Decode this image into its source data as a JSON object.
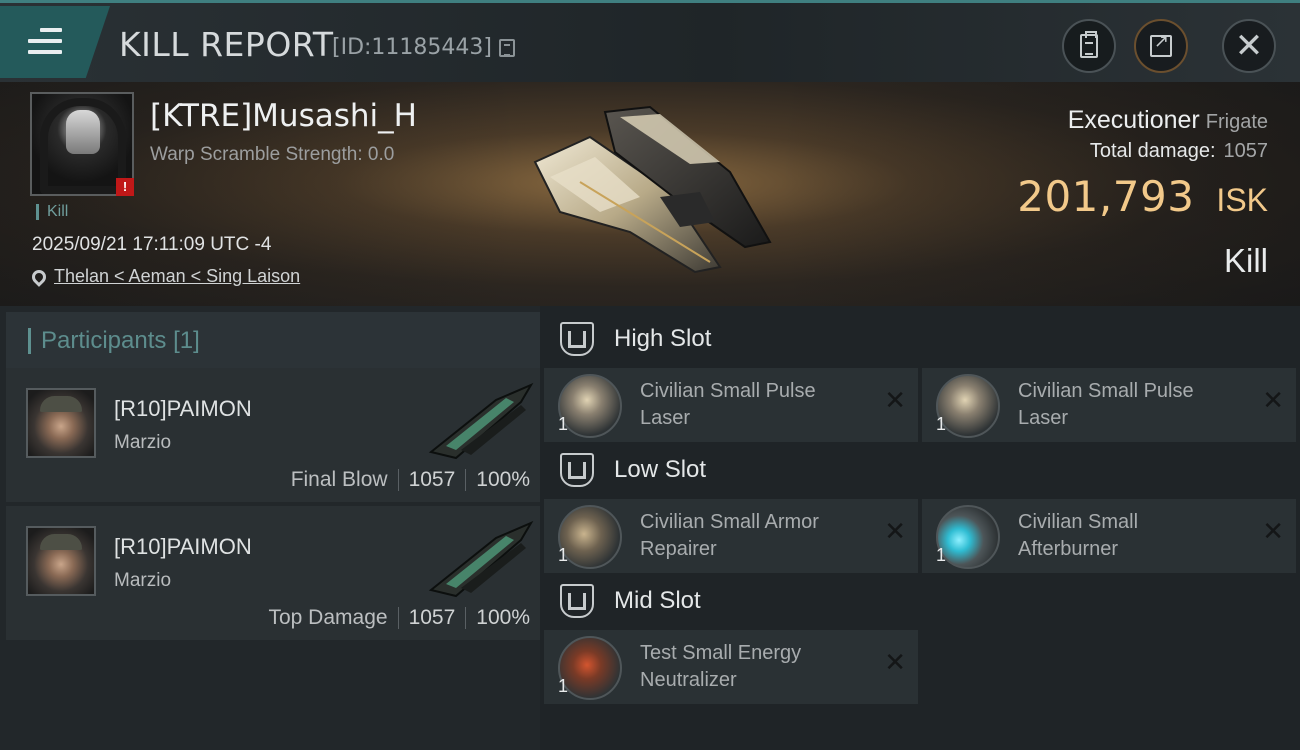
{
  "header": {
    "title": "KILL REPORT",
    "id_text": "[ID:11185443]"
  },
  "victim": {
    "name": "[KTRE]Musashi_H",
    "warp_scramble": "Warp Scramble Strength: 0.0",
    "kill_tag": "Kill",
    "datetime": "2025/09/21 17:11:09 UTC -4",
    "location": "Thelan < Aeman < Sing Laison",
    "ship_name": "Executioner",
    "ship_class": "Frigate",
    "total_damage_label": "Total damage:",
    "total_damage_value": "1057",
    "isk_value": "201,793",
    "isk_unit": "ISK",
    "outcome": "Kill"
  },
  "participants": {
    "title": "Participants",
    "count": "[1]",
    "rows": [
      {
        "name": "[R10]PAIMON",
        "ship": "Marzio",
        "label": "Final Blow",
        "damage": "1057",
        "percent": "100%"
      },
      {
        "name": "[R10]PAIMON",
        "ship": "Marzio",
        "label": "Top Damage",
        "damage": "1057",
        "percent": "100%"
      }
    ]
  },
  "fitting": {
    "high_slot": {
      "title": "High Slot",
      "modules": [
        {
          "name": "Civilian Small Pulse Laser",
          "qty": "1",
          "icon": "laser-icon"
        },
        {
          "name": "Civilian Small Pulse Laser",
          "qty": "1",
          "icon": "laser-icon"
        }
      ]
    },
    "low_slot": {
      "title": "Low Slot",
      "modules": [
        {
          "name": "Civilian Small Armor Repairer",
          "qty": "1",
          "icon": "armor-repairer-icon"
        },
        {
          "name": "Civilian Small Afterburner",
          "qty": "1",
          "icon": "afterburner-icon"
        }
      ]
    },
    "mid_slot": {
      "title": "Mid Slot",
      "modules": [
        {
          "name": "Test Small Energy Neutralizer",
          "qty": "1",
          "icon": "energy-neutralizer-icon"
        }
      ]
    }
  },
  "colors": {
    "accent_teal": "#5e9190",
    "isk_gold": "#f2c98a",
    "header_tab": "#245a5b"
  }
}
